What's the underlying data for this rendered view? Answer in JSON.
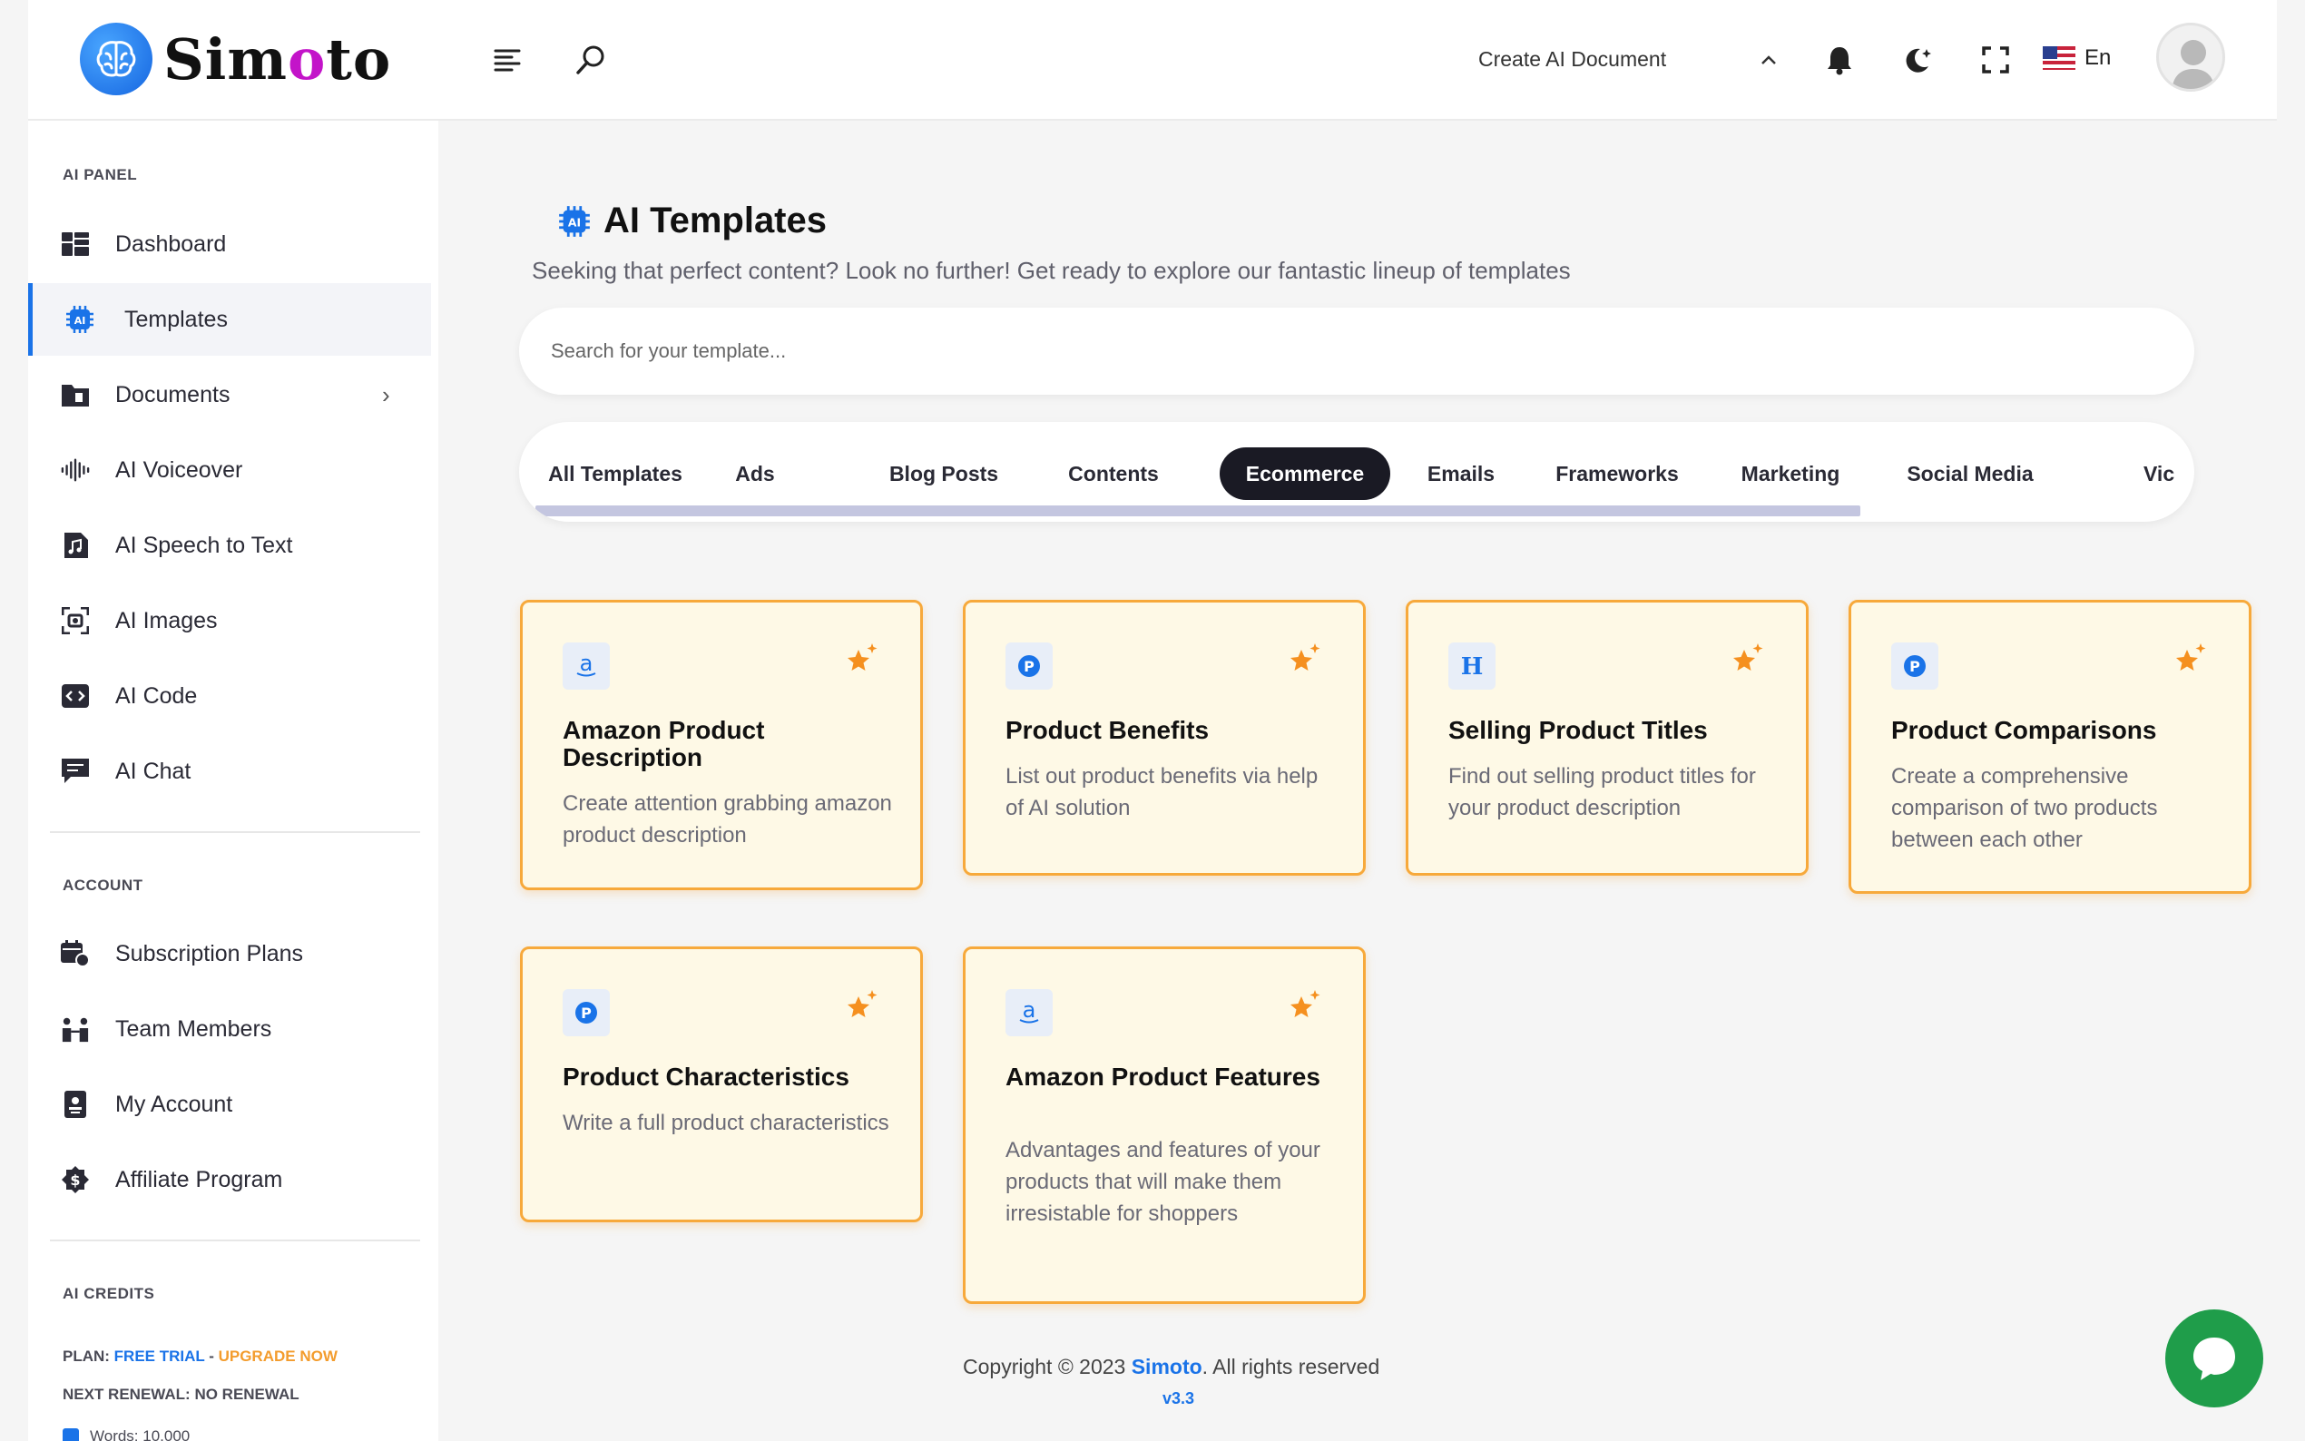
{
  "header": {
    "brand": "Simoto",
    "create_doc_label": "Create AI Document",
    "language": "En"
  },
  "sidebar": {
    "sections": {
      "ai_panel": "AI PANEL",
      "account": "ACCOUNT",
      "credits": "AI CREDITS"
    },
    "ai_items": [
      {
        "label": "Dashboard",
        "icon": "dashboard-icon"
      },
      {
        "label": "Templates",
        "icon": "ai-chip-icon"
      },
      {
        "label": "Documents",
        "icon": "folder-icon"
      },
      {
        "label": "AI Voiceover",
        "icon": "waveform-icon"
      },
      {
        "label": "AI Speech to Text",
        "icon": "music-file-icon"
      },
      {
        "label": "AI Images",
        "icon": "image-scan-icon"
      },
      {
        "label": "AI Code",
        "icon": "code-icon"
      },
      {
        "label": "AI Chat",
        "icon": "chat-icon"
      }
    ],
    "account_items": [
      {
        "label": "Subscription Plans",
        "icon": "calendar-plan-icon"
      },
      {
        "label": "Team Members",
        "icon": "team-icon"
      },
      {
        "label": "My Account",
        "icon": "id-badge-icon"
      },
      {
        "label": "Affiliate Program",
        "icon": "dollar-badge-icon"
      }
    ],
    "credits": {
      "plan_prefix": "PLAN: ",
      "plan_value": "FREE TRIAL",
      "plan_sep": " - ",
      "upgrade": "UPGRADE NOW",
      "renewal": "NEXT RENEWAL: NO RENEWAL",
      "words": "Words: 10,000"
    }
  },
  "main": {
    "title": "AI Templates",
    "subtitle": "Seeking that perfect content? Look no further! Get ready to explore our fantastic lineup of templates",
    "search_placeholder": "Search for your template...",
    "tabs": [
      "All Templates",
      "Ads",
      "Blog Posts",
      "Contents",
      "Ecommerce",
      "Emails",
      "Frameworks",
      "Marketing",
      "Social Media",
      "Vic"
    ],
    "active_tab": "Ecommerce",
    "cards": [
      {
        "title": "Amazon Product Description",
        "desc": "Create attention grabbing amazon product description",
        "icon": "amazon-icon"
      },
      {
        "title": "Product Benefits",
        "desc": "List out product benefits via help of AI solution",
        "icon": "product-p-icon"
      },
      {
        "title": "Selling Product Titles",
        "desc": "Find out selling product titles for your product description",
        "icon": "heading-h-icon"
      },
      {
        "title": "Product Comparisons",
        "desc": "Create a comprehensive comparison of two products between each other",
        "icon": "product-p-icon"
      },
      {
        "title": "Product Characteristics",
        "desc": "Write a full product characteristics",
        "icon": "product-p-icon"
      },
      {
        "title": "Amazon Product Features",
        "desc": "Advantages and features of your products that will make them irresistable for shoppers",
        "icon": "amazon-icon"
      }
    ]
  },
  "footer": {
    "copyright_prefix": "Copyright © 2023 ",
    "brand": "Simoto",
    "copyright_suffix": ". All rights reserved",
    "version": "v3.3"
  },
  "colors": {
    "accent": "#1a73e8",
    "card_border": "#f7a93b",
    "card_bg": "#fef9e6",
    "chat": "#1f9d4a"
  }
}
